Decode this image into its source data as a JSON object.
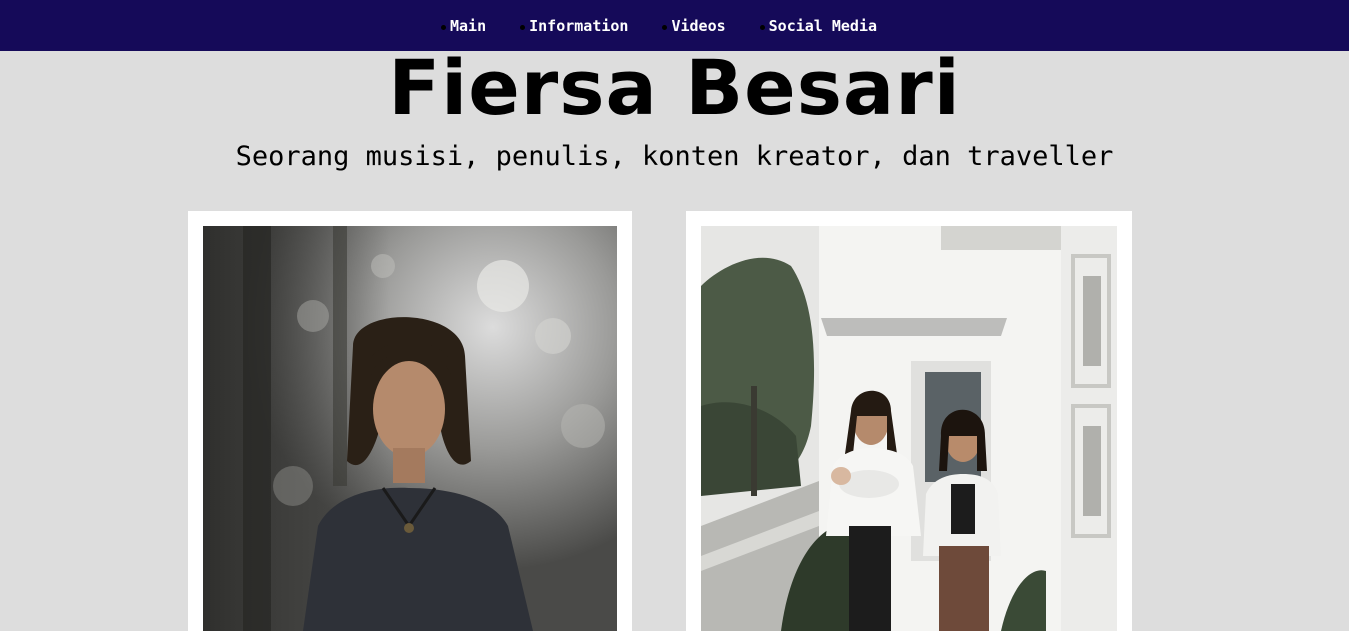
{
  "nav": {
    "items": [
      {
        "label": "Main"
      },
      {
        "label": "Information"
      },
      {
        "label": "Videos"
      },
      {
        "label": "Social Media"
      }
    ]
  },
  "header": {
    "title": "Fiersa Besari",
    "subtitle": "Seorang musisi, penulis, konten kreator, dan traveller"
  },
  "gallery": {
    "photos": [
      {
        "subject": "portrait-photo"
      },
      {
        "subject": "family-photo"
      }
    ]
  },
  "colors": {
    "navbar": "#150a59",
    "background": "#dddddd",
    "card": "#ffffff"
  }
}
